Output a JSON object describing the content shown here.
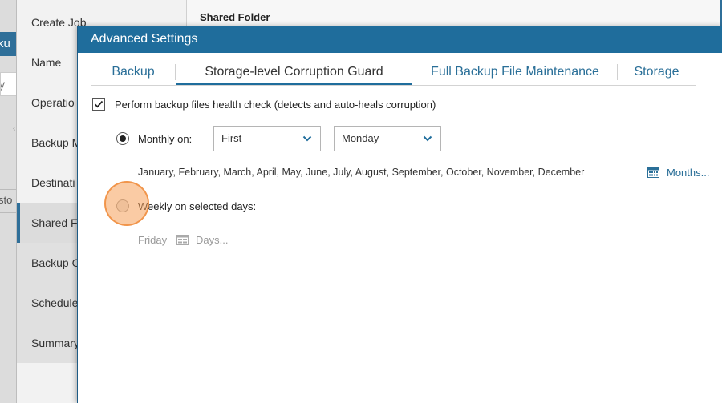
{
  "background": {
    "left_tab_text": "ku",
    "left_field_text": "y",
    "left_row_text": "sto",
    "wizard_header_title": "Shared Folder",
    "wizard_steps": [
      "Create Job",
      "Name",
      "Operatio",
      "Backup M",
      "Destinati",
      "Shared Fo",
      "Backup O",
      "Schedule",
      "Summary"
    ],
    "active_step_index": 5
  },
  "dialog": {
    "title": "Advanced Settings",
    "tabs": [
      {
        "label": "Backup",
        "active": false
      },
      {
        "label": "Storage-level Corruption Guard",
        "active": true
      },
      {
        "label": "Full Backup File Maintenance",
        "active": false
      },
      {
        "label": "Storage",
        "active": false
      }
    ],
    "health_check": {
      "label": "Perform backup files health check (detects and auto-heals corruption)",
      "checked": true
    },
    "monthly": {
      "label": "Monthly on:",
      "selected": true,
      "week_select": "First",
      "day_select": "Monday",
      "months_list": "January, February, March, April, May, June, July, August, September, October, November, December",
      "months_link": "Months..."
    },
    "weekly": {
      "label": "Weekly on selected days:",
      "selected": false,
      "days_value": "Friday",
      "days_link": "Days..."
    }
  },
  "colors": {
    "accent": "#1f6d9c",
    "link": "#2a6f98",
    "click_highlight": "#f5a05a"
  },
  "icons": [
    "checkmark-icon",
    "chevron-down-icon",
    "calendar-icon"
  ]
}
